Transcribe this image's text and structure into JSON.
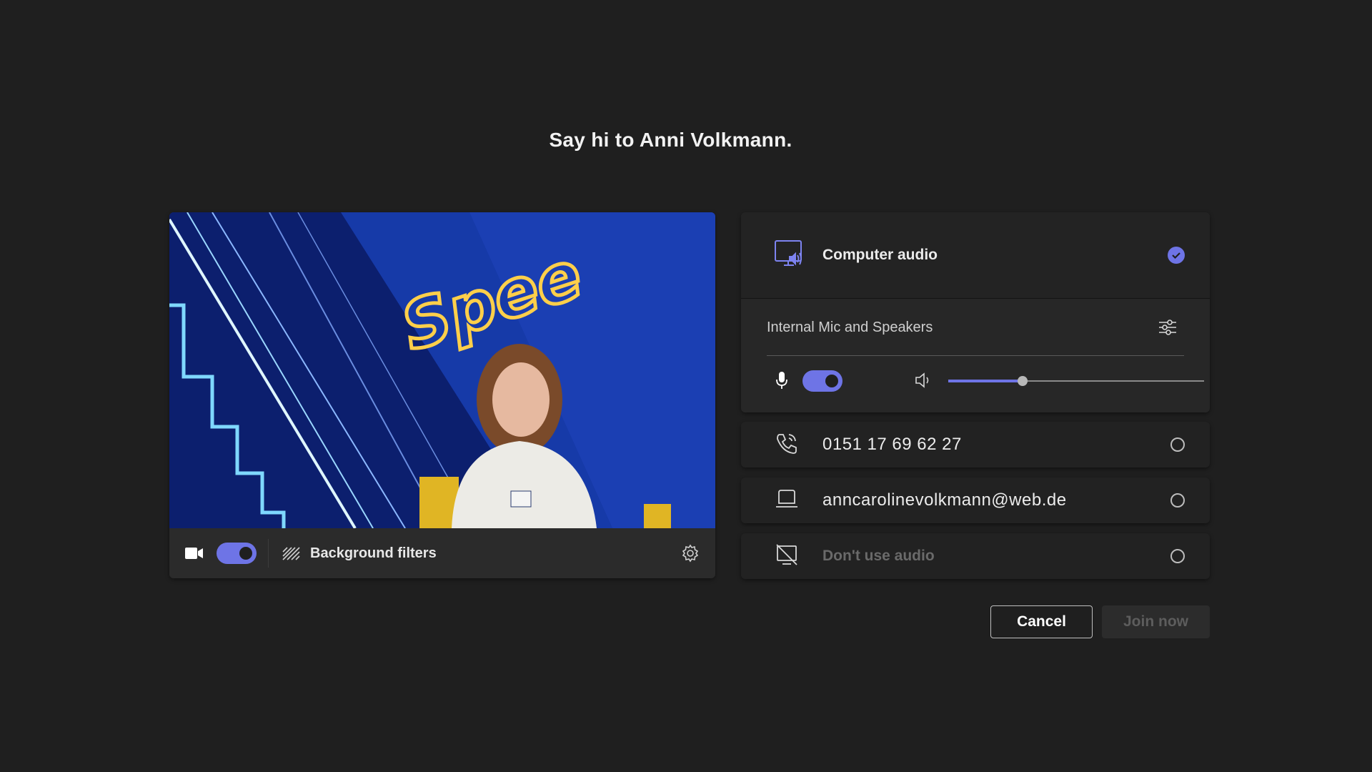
{
  "header": {
    "title": "Say hi to Anni Volkmann."
  },
  "video": {
    "camera_enabled": true,
    "background_filters_label": "Background filters",
    "icons": [
      "video-camera-icon",
      "background-filters-icon",
      "gear-icon"
    ]
  },
  "audio": {
    "computer_audio": {
      "label": "Computer audio",
      "selected": true
    },
    "device": {
      "label": "Internal Mic and Speakers"
    },
    "mic_enabled": true,
    "speaker_volume": 0.29,
    "options": [
      {
        "label": "0151 17 69 62 27",
        "selected": false,
        "icon": "phone-icon"
      },
      {
        "label": "anncarolinevolkmann@web.de",
        "selected": false,
        "icon": "laptop-icon"
      },
      {
        "label": "Don't use audio",
        "selected": false,
        "icon": "no-audio-icon"
      }
    ]
  },
  "actions": {
    "cancel": "Cancel",
    "join": "Join now"
  },
  "colors": {
    "accent": "#6e74e6",
    "background": "#1f1f1f",
    "card": "#272727"
  }
}
